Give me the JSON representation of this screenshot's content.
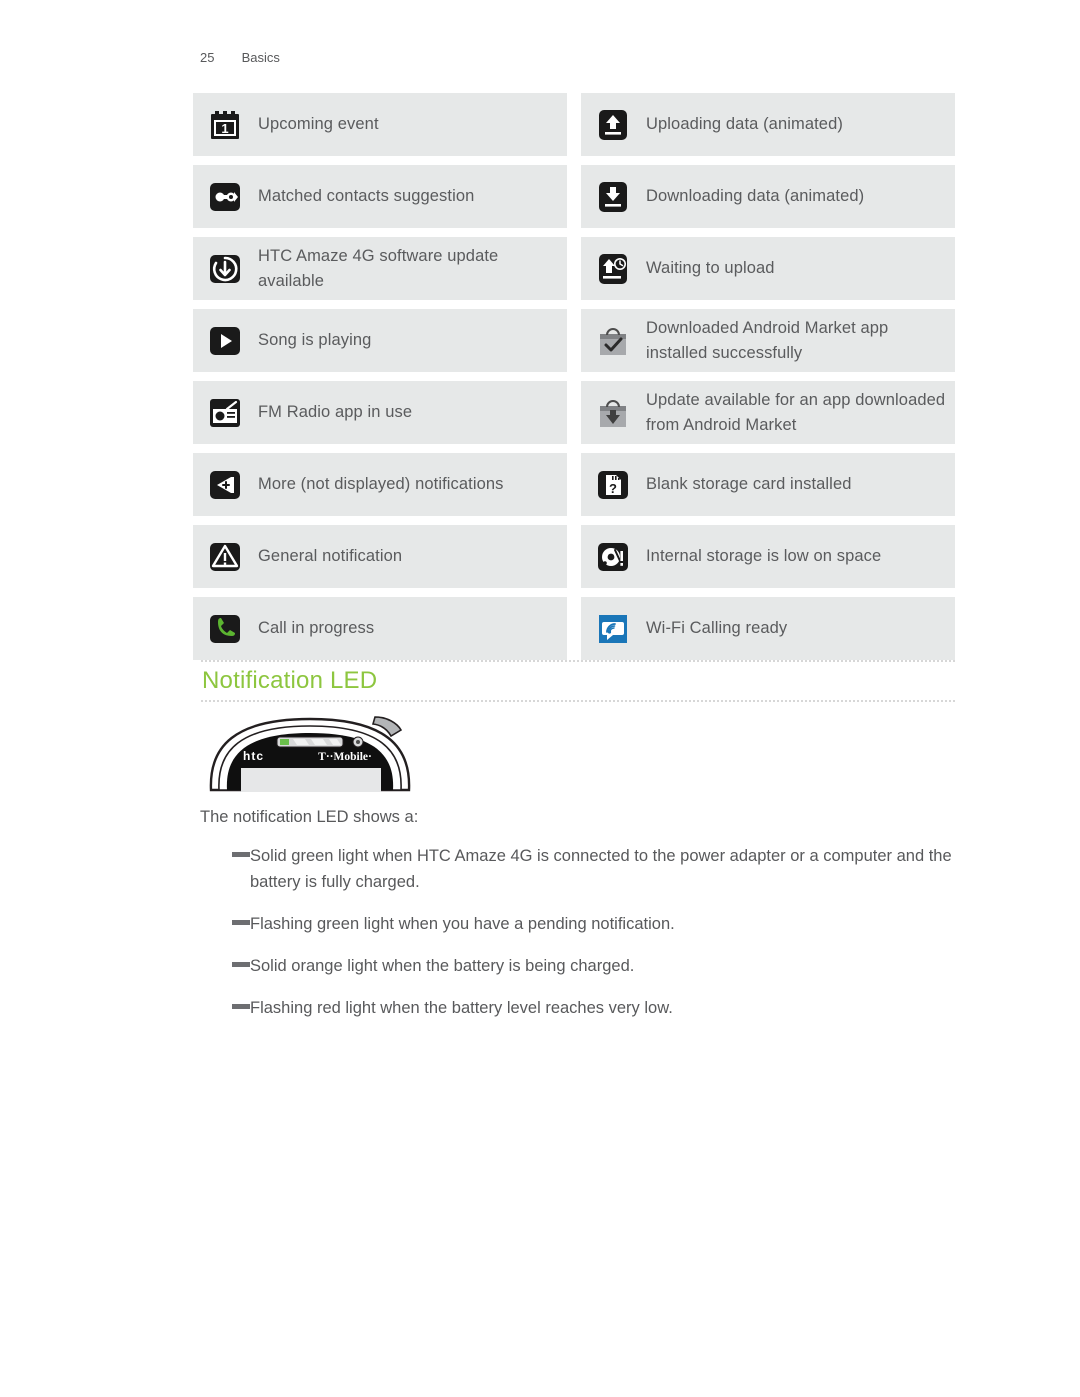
{
  "header": {
    "page_number": "25",
    "section": "Basics"
  },
  "icon_table": {
    "left_column": [
      {
        "icon": "calendar-event-icon",
        "label": "Upcoming event"
      },
      {
        "icon": "matched-contacts-icon",
        "label": "Matched contacts suggestion"
      },
      {
        "icon": "software-update-icon",
        "label": "HTC Amaze 4G software update available"
      },
      {
        "icon": "music-play-icon",
        "label": "Song is playing"
      },
      {
        "icon": "fm-radio-icon",
        "label": "FM Radio app in use"
      },
      {
        "icon": "more-notifications-icon",
        "label": "More (not displayed) notifications"
      },
      {
        "icon": "general-notification-icon",
        "label": "General notification"
      },
      {
        "icon": "call-in-progress-icon",
        "label": "Call in progress"
      }
    ],
    "right_column": [
      {
        "icon": "upload-icon",
        "label": "Uploading data (animated)"
      },
      {
        "icon": "download-icon",
        "label": "Downloading data (animated)"
      },
      {
        "icon": "waiting-upload-icon",
        "label": "Waiting to upload"
      },
      {
        "icon": "market-installed-icon",
        "label": "Downloaded Android Market app installed successfully"
      },
      {
        "icon": "market-update-icon",
        "label": "Update available for an app downloaded from Android Market"
      },
      {
        "icon": "blank-storage-card-icon",
        "label": "Blank storage card installed"
      },
      {
        "icon": "internal-storage-low-icon",
        "label": "Internal storage is low on space"
      },
      {
        "icon": "wifi-calling-icon",
        "label": "Wi-Fi Calling ready"
      }
    ]
  },
  "section": {
    "title": "Notification LED",
    "phone_image": {
      "brand_label": "htc",
      "carrier_label": "T··Mobile·",
      "led_color": "#6abf4b"
    },
    "lead_text": "The notification LED shows a:",
    "bullets": [
      "Solid green light when HTC Amaze 4G is connected to the power adapter or a computer and the battery is fully charged.",
      "Flashing green light when you have a pending notification.",
      "Solid orange light when the battery is being charged.",
      "Flashing red light when the battery level reaches very low."
    ]
  },
  "colors": {
    "row_background": "#e6e8e8",
    "heading_green": "#8dc63f",
    "body_text": "#58595b",
    "wifi_icon_blue": "#1a76b8"
  }
}
